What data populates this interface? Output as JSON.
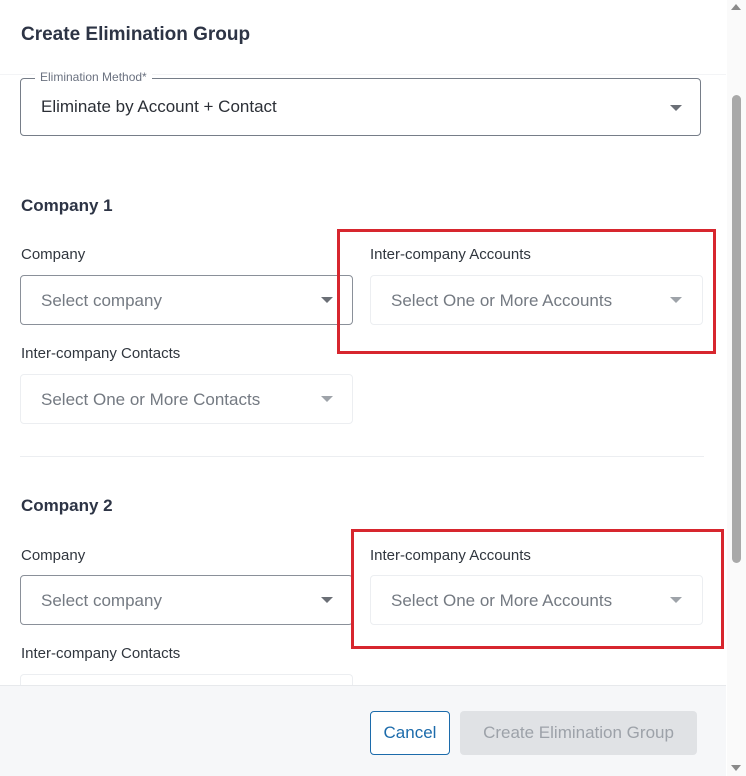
{
  "modal": {
    "title": "Create Elimination Group"
  },
  "elimination_method": {
    "label": "Elimination Method*",
    "value": "Eliminate by Account + Contact"
  },
  "company1": {
    "title": "Company 1",
    "company_label": "Company",
    "company_placeholder": "Select company",
    "accounts_label": "Inter-company Accounts",
    "accounts_placeholder": "Select One or More Accounts",
    "contacts_label": "Inter-company Contacts",
    "contacts_placeholder": "Select One or More Contacts"
  },
  "company2": {
    "title": "Company 2",
    "company_label": "Company",
    "company_placeholder": "Select company",
    "accounts_label": "Inter-company Accounts",
    "accounts_placeholder": "Select One or More Accounts",
    "contacts_label": "Inter-company Contacts"
  },
  "footer": {
    "cancel_label": "Cancel",
    "create_label": "Create Elimination Group"
  },
  "colors": {
    "highlight": "#d7262e",
    "primary": "#1c6bab",
    "disabled_bg": "#e0e2e5"
  },
  "icons": {
    "dropdown": "chevron-down-icon",
    "scroll_up": "scroll-up-arrow-icon",
    "scroll_down": "scroll-down-arrow-icon"
  }
}
